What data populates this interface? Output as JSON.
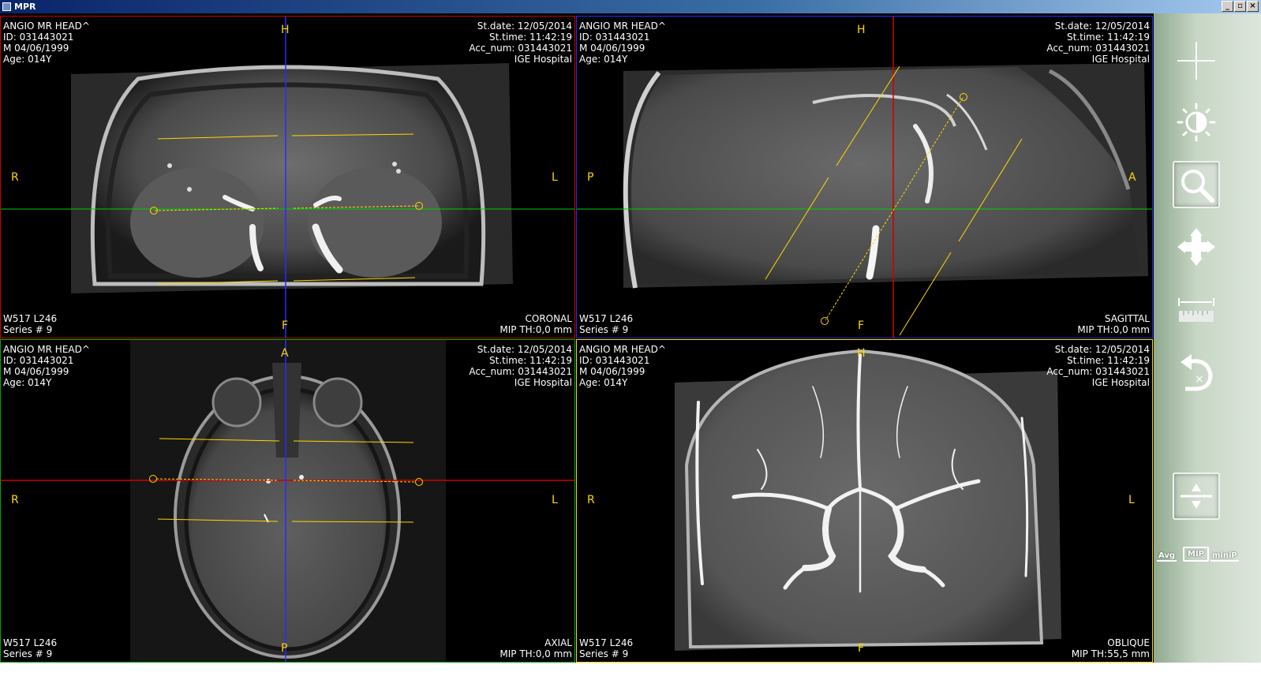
{
  "window": {
    "title": "MPR"
  },
  "viewports": [
    {
      "key": "coronal",
      "patient": {
        "name": "ANGIO MR HEAD^",
        "id": "ID: 031443021",
        "dob": "M 04/06/1999",
        "age": "Age: 014Y"
      },
      "study": {
        "date": "St.date: 12/05/2014",
        "time": "St.time: 11:42:19",
        "acc": "Acc_num: 031443021",
        "hospital": "IGE Hospital"
      },
      "window_level": "W517 L246",
      "series": "Series # 9",
      "plane": "CORONAL",
      "mip": "MIP TH:0,0 mm",
      "orient": {
        "top": "H",
        "bottom": "F",
        "left": "R",
        "right": "L"
      },
      "border_color": "#cc0000",
      "crosshair_colors": {
        "vertical": "#2a2aff",
        "horizontal": "#00cc00"
      }
    },
    {
      "key": "sagittal",
      "patient": {
        "name": "ANGIO MR HEAD^",
        "id": "ID: 031443021",
        "dob": "M 04/06/1999",
        "age": "Age: 014Y"
      },
      "study": {
        "date": "St.date: 12/05/2014",
        "time": "St.time: 11:42:19",
        "acc": "Acc_num: 031443021",
        "hospital": "IGE Hospital"
      },
      "window_level": "W517 L246",
      "series": "Series # 9",
      "plane": "SAGITTAL",
      "mip": "MIP TH:0,0 mm",
      "orient": {
        "top": "H",
        "bottom": "F",
        "left": "P",
        "right": "A"
      },
      "border_color": "#2a2aff",
      "crosshair_colors": {
        "vertical": "#cc0000",
        "horizontal": "#00cc00"
      }
    },
    {
      "key": "axial",
      "patient": {
        "name": "ANGIO MR HEAD^",
        "id": "ID: 031443021",
        "dob": "M 04/06/1999",
        "age": "Age: 014Y"
      },
      "study": {
        "date": "St.date: 12/05/2014",
        "time": "St.time: 11:42:19",
        "acc": "Acc_num: 031443021",
        "hospital": "IGE Hospital"
      },
      "window_level": "W517 L246",
      "series": "Series # 9",
      "plane": "AXIAL",
      "mip": "MIP TH:0,0 mm",
      "orient": {
        "top": "A",
        "bottom": "P",
        "left": "R",
        "right": "L"
      },
      "border_color": "#00aa00",
      "crosshair_colors": {
        "vertical": "#2a2aff",
        "horizontal": "#cc0000"
      }
    },
    {
      "key": "oblique",
      "patient": {
        "name": "ANGIO MR HEAD^",
        "id": "ID: 031443021",
        "dob": "M 04/06/1999",
        "age": "Age: 014Y"
      },
      "study": {
        "date": "St.date: 12/05/2014",
        "time": "St.time: 11:42:19",
        "acc": "Acc_num: 031443021",
        "hospital": "IGE Hospital"
      },
      "window_level": "W517 L246",
      "series": "Series # 9",
      "plane": "OBLIQUE",
      "mip": "MIP TH:55,5 mm",
      "orient": {
        "top": "H",
        "bottom": "F",
        "left": "R",
        "right": "L"
      },
      "border_color": "#ffd700"
    }
  ],
  "toolbar": {
    "tools": [
      {
        "icon": "crosshair-icon"
      },
      {
        "icon": "window-level-icon"
      },
      {
        "icon": "zoom-icon",
        "active": true
      },
      {
        "icon": "pan-icon"
      },
      {
        "icon": "measure-icon"
      },
      {
        "icon": "reset-icon"
      },
      {
        "icon": "thickness-icon"
      }
    ],
    "modes": {
      "avg": "Avg",
      "mip": "MIP",
      "minip": "miniP",
      "selected": "MIP"
    }
  },
  "colors": {
    "overlay_text": "#ffffff",
    "orientation_text": "#ffd700",
    "slab_lines": "#ffd700"
  }
}
